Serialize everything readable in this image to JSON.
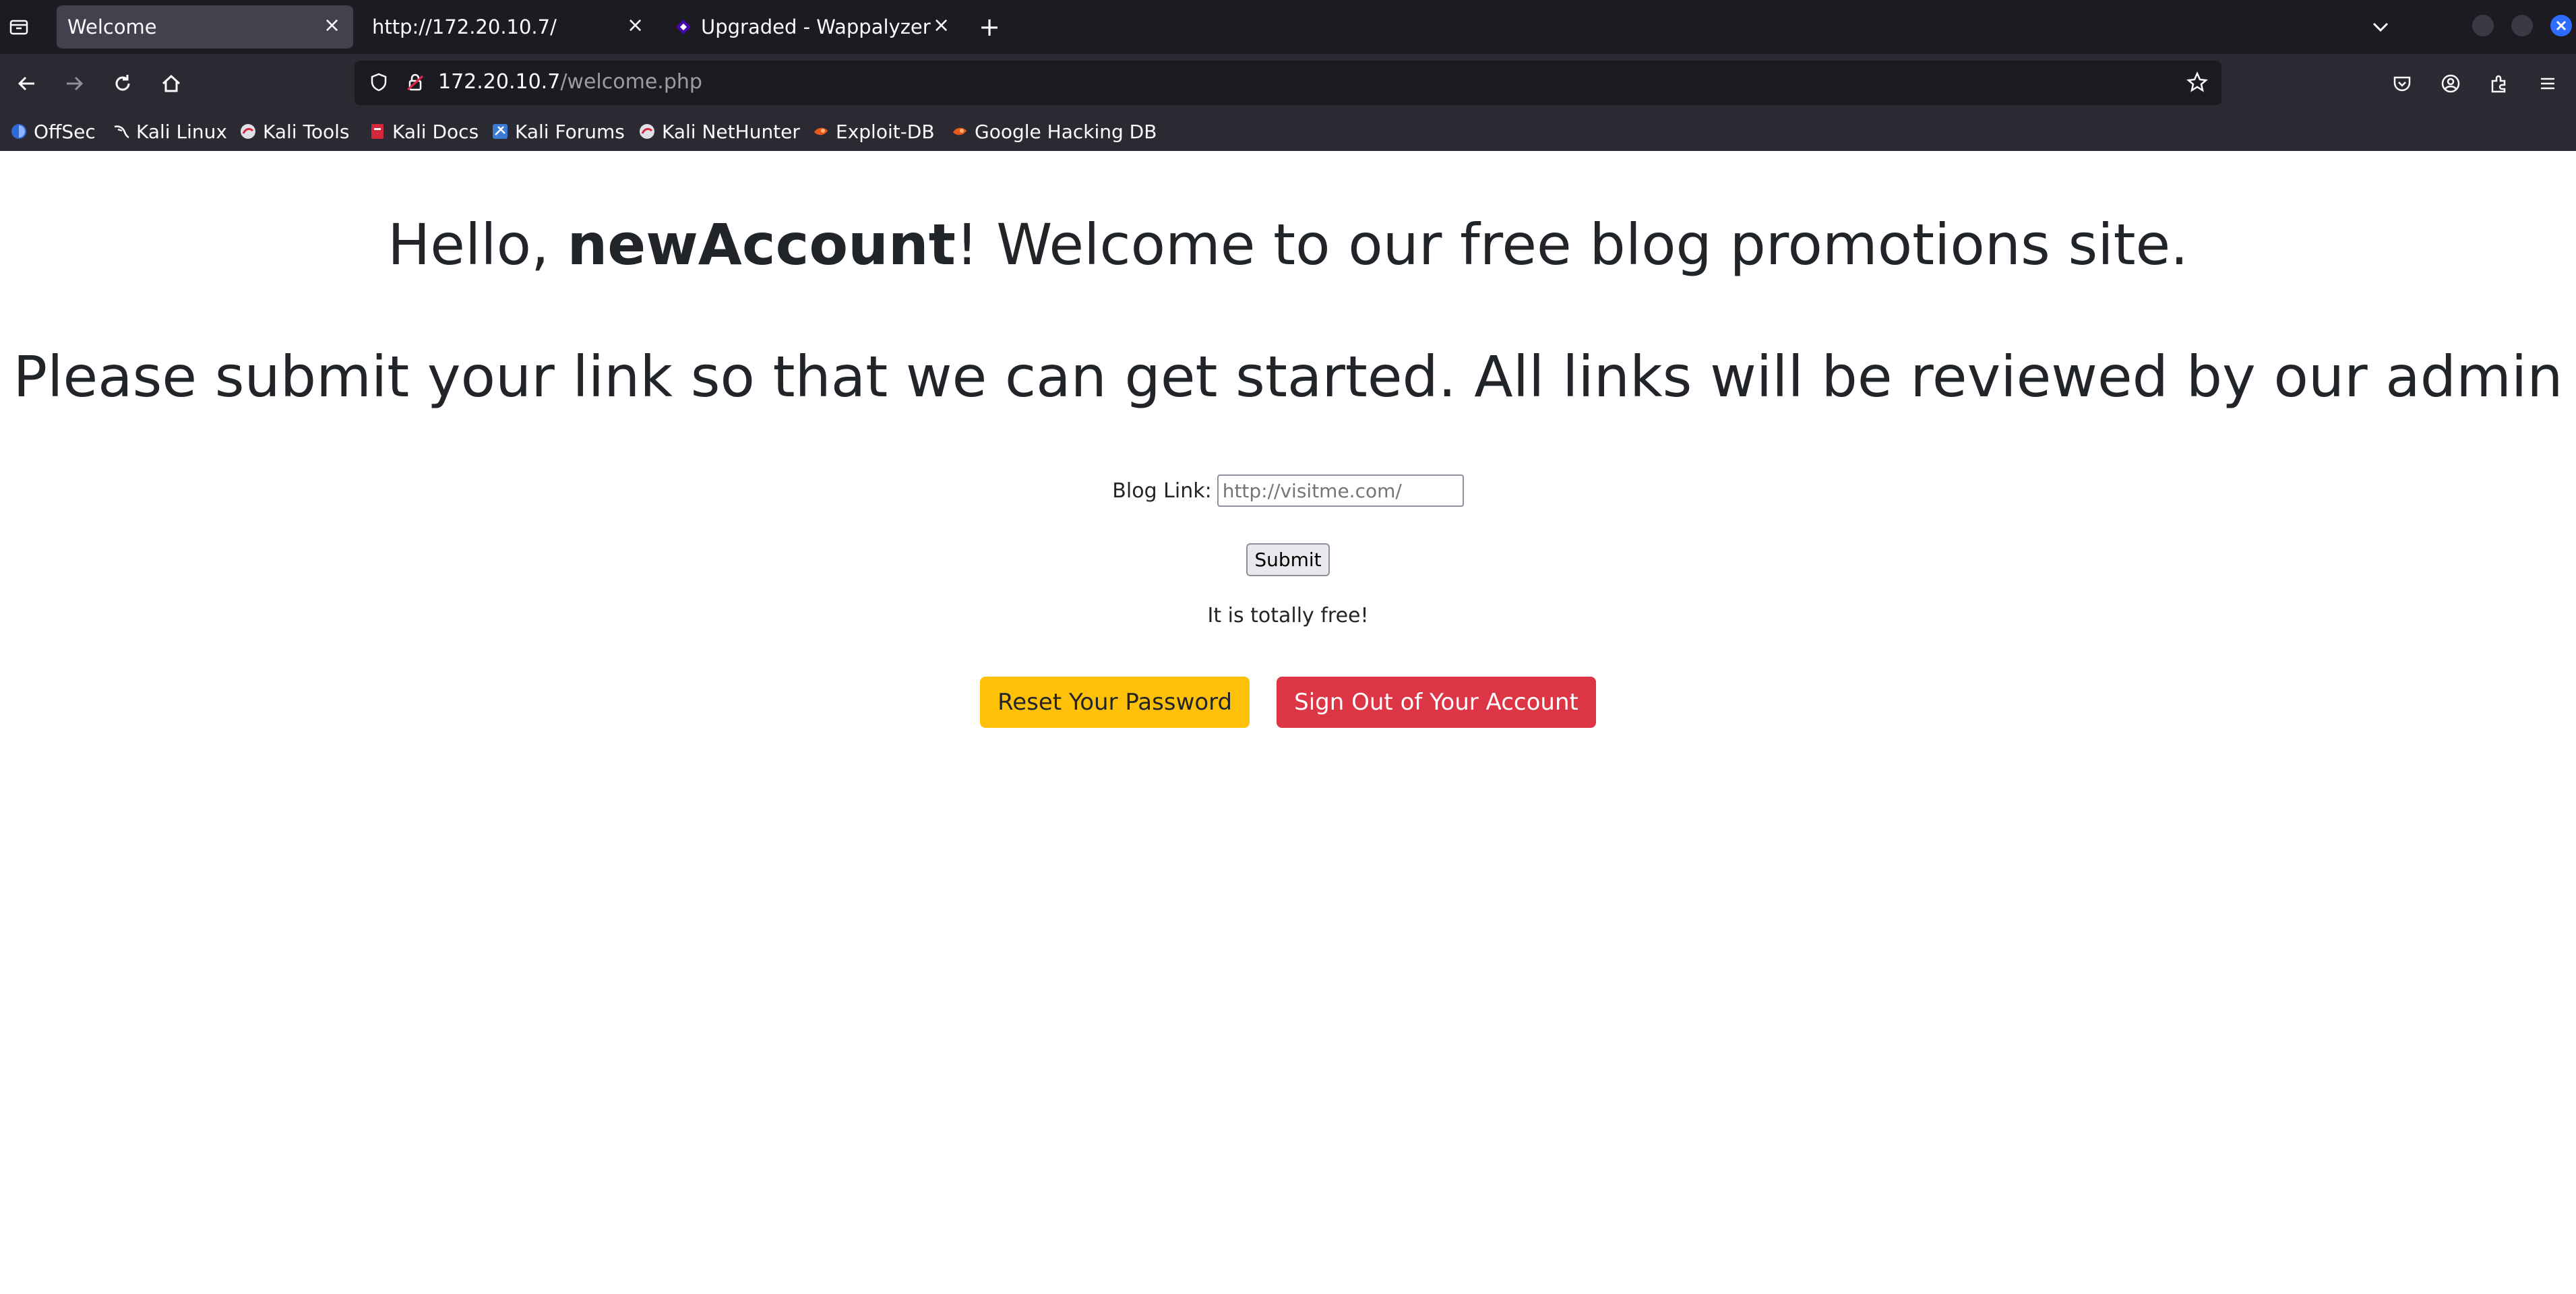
{
  "browser": {
    "tabs": [
      {
        "label": "Welcome",
        "active": true
      },
      {
        "label": "http://172.20.10.7/",
        "active": false
      },
      {
        "label": "Upgraded - Wappalyzer",
        "active": false
      }
    ],
    "close_glyph": "×",
    "new_tab_glyph": "+",
    "url": {
      "host": "172.20.10.7",
      "path": "/welcome.php"
    },
    "bookmarks": [
      {
        "label": "OffSec",
        "icon": "offsec-icon"
      },
      {
        "label": "Kali Linux",
        "icon": "kali-dragon-icon"
      },
      {
        "label": "Kali Tools",
        "icon": "kali-tools-icon"
      },
      {
        "label": "Kali Docs",
        "icon": "kali-docs-icon"
      },
      {
        "label": "Kali Forums",
        "icon": "kali-forums-icon"
      },
      {
        "label": "Kali NetHunter",
        "icon": "kali-nethunter-icon"
      },
      {
        "label": "Exploit-DB",
        "icon": "exploit-db-icon"
      },
      {
        "label": "Google Hacking DB",
        "icon": "ghdb-icon"
      }
    ]
  },
  "page": {
    "greeting_prefix": "Hello, ",
    "username": "newAccount",
    "greeting_suffix": "! Welcome to our free blog promotions site.",
    "subheading": "Please submit your link so that we can get started. All links will be reviewed by our admin",
    "form": {
      "label": "Blog Link:",
      "placeholder": "http://visitme.com/",
      "value": "",
      "submit_label": "Submit"
    },
    "note": "It is totally free!",
    "buttons": {
      "reset": "Reset Your Password",
      "signout": "Sign Out of Your Account"
    }
  },
  "colors": {
    "warning": "#ffc107",
    "danger": "#dc3545",
    "chrome_dark": "#1c1b22",
    "chrome": "#2b2a33"
  }
}
